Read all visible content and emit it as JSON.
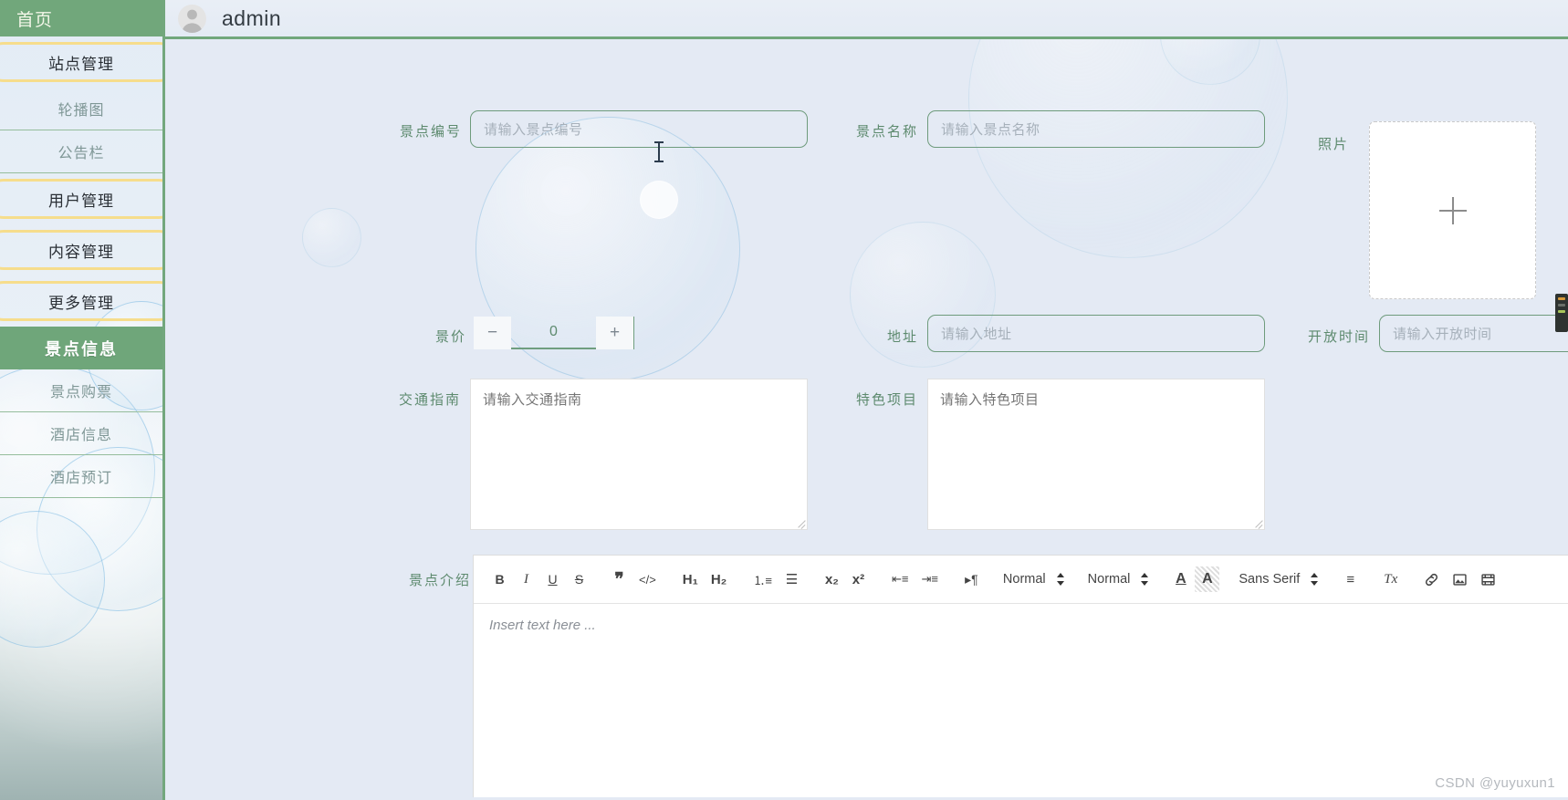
{
  "sidebar": {
    "home_label": "首页",
    "groups": [
      {
        "label": "站点管理",
        "items": [
          {
            "label": "轮播图"
          },
          {
            "label": "公告栏"
          }
        ]
      },
      {
        "label": "用户管理",
        "items": []
      },
      {
        "label": "内容管理",
        "items": []
      },
      {
        "label": "更多管理",
        "items": [
          {
            "label": "景点信息",
            "active": true
          },
          {
            "label": "景点购票",
            "active": false
          },
          {
            "label": "酒店信息",
            "active": false
          },
          {
            "label": "酒店预订",
            "active": false
          }
        ]
      }
    ]
  },
  "topbar": {
    "avatar_icon": "user-avatar-icon",
    "user_name": "admin"
  },
  "form": {
    "spot_code": {
      "label": "景点编号",
      "placeholder": "请输入景点编号",
      "value": ""
    },
    "spot_name": {
      "label": "景点名称",
      "placeholder": "请输入景点名称",
      "value": ""
    },
    "photo": {
      "label": "照片",
      "upload_icon": "plus-icon"
    },
    "price": {
      "label": "景价",
      "value": "0",
      "minus": "−",
      "plus": "+"
    },
    "address": {
      "label": "地址",
      "placeholder": "请输入地址",
      "value": ""
    },
    "open_time": {
      "label": "开放时间",
      "placeholder": "请输入开放时间",
      "value": ""
    },
    "traffic_guide": {
      "label": "交通指南",
      "placeholder": "请输入交通指南",
      "value": ""
    },
    "features": {
      "label": "特色项目",
      "placeholder": "请输入特色项目",
      "value": ""
    },
    "introduction": {
      "label": "景点介绍",
      "placeholder": "Insert text here ..."
    }
  },
  "editor_toolbar": {
    "bold": "B",
    "italic": "I",
    "underline": "U",
    "strike": "S",
    "blockquote": "❞",
    "code_block": "</>",
    "header1": "H₁",
    "header2": "H₂",
    "list_ordered": "⒈≡",
    "list_bullet": "☰",
    "subscript": "x₂",
    "superscript": "x²",
    "outdent": "⇤≡",
    "indent": "⇥≡",
    "direction": "▸¶",
    "header_select": "Normal",
    "size_select": "Normal",
    "color_icon": "A",
    "background_icon": "A",
    "font_select": "Sans Serif",
    "align_icon": "≡",
    "clean_icon": "Tx",
    "link_icon": "link-icon",
    "image_icon": "image-icon",
    "video_icon": "video-icon"
  },
  "watermark": {
    "text": "CSDN @yuyuxun1"
  },
  "theme": {
    "sidebar_head_bg": "#71a77b",
    "active_bg": "#6fa67a",
    "group_border": "#f6dd8c",
    "field_border": "#6e9b7c",
    "label_color": "#5d8a6e",
    "page_bg": "#e4eaf4"
  }
}
